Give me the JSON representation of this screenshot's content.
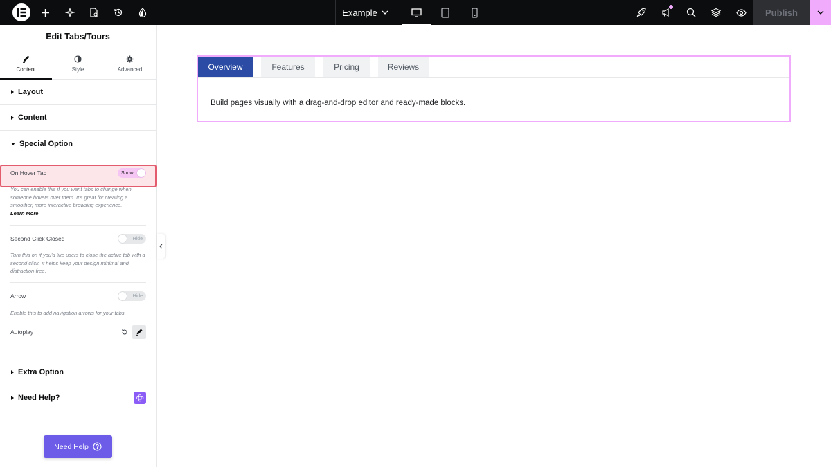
{
  "topbar": {
    "page_name": "Example",
    "publish_label": "Publish",
    "accent_color": "#f0abfc"
  },
  "panel": {
    "title": "Edit Tabs/Tours",
    "tabs": [
      {
        "label": "Content",
        "icon": "pencil-icon"
      },
      {
        "label": "Style",
        "icon": "half-circle-icon"
      },
      {
        "label": "Advanced",
        "icon": "gear-icon"
      }
    ],
    "sections": {
      "layout": "Layout",
      "content": "Content",
      "special": "Special Option",
      "extra": "Extra Option",
      "help": "Need Help?"
    },
    "controls": {
      "hover_tab": {
        "label": "On Hover Tab",
        "state": "Show",
        "description": "You can enable this if you want tabs to change when someone hovers over them. It's great for creating a smoother, more interactive browsing experience.",
        "learn_more": "Learn More"
      },
      "second_click": {
        "label": "Second Click Closed",
        "state": "Hide",
        "description": "Turn this on if you'd like users to close the active tab with a second click. It helps keep your design minimal and distraction-free."
      },
      "arrow": {
        "label": "Arrow",
        "state": "Hide",
        "description": "Enable this to add navigation arrows for your tabs."
      },
      "autoplay": {
        "label": "Autoplay"
      }
    },
    "need_help_button": "Need Help"
  },
  "canvas": {
    "tabs": [
      "Overview",
      "Features",
      "Pricing",
      "Reviews"
    ],
    "active_tab": "Overview",
    "content_text": "Build pages visually with a drag-and-drop editor and ready-made blocks.",
    "active_color": "#2b4ba5"
  }
}
